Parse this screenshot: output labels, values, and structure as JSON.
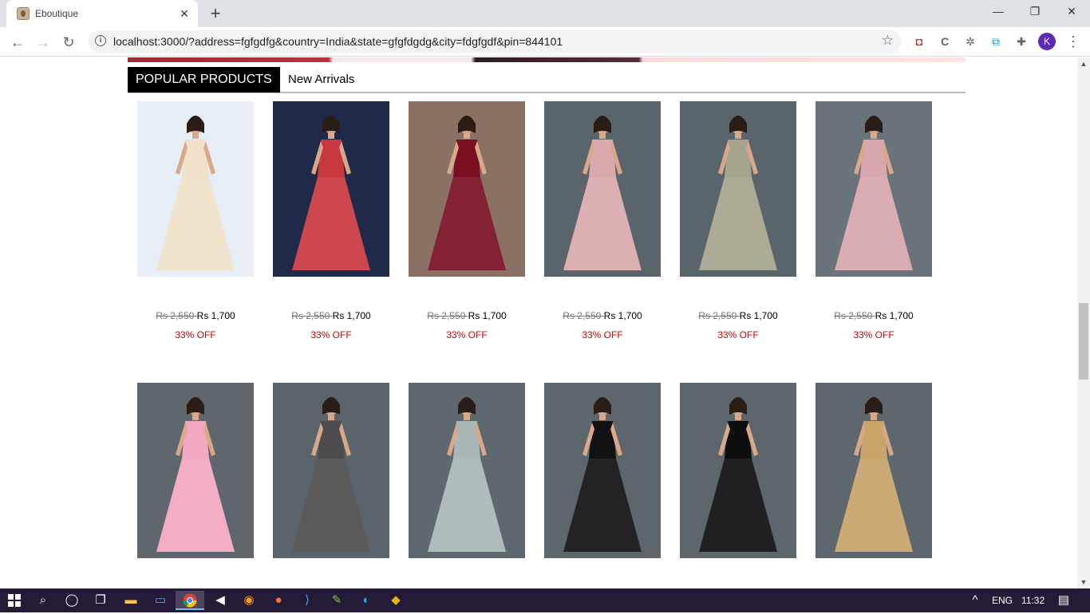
{
  "browser": {
    "tab_title": "Eboutique",
    "new_tab_symbol": "+",
    "url": "localhost:3000/?address=fgfgdfg&country=India&state=gfgfdgdg&city=fdgfgdf&pin=844101",
    "profile_initial": "K",
    "window_controls": {
      "minimize": "—",
      "restore": "❐",
      "close": "✕"
    }
  },
  "page": {
    "tabs": {
      "popular": "POPULAR PRODUCTS",
      "new_arrivals": "New Arrivals"
    },
    "products": [
      {
        "old_price": "Rs 2,550 ",
        "price": "Rs 1,700",
        "discount": "33% OFF",
        "dress_color": "#efe2c8",
        "background": "#e8eef5"
      },
      {
        "old_price": "Rs 2,550 ",
        "price": "Rs 1,700",
        "discount": "33% OFF",
        "dress_color": "#c8383f",
        "background": "#1e2a47"
      },
      {
        "old_price": "Rs 2,550 ",
        "price": "Rs 1,700",
        "discount": "33% OFF",
        "dress_color": "#7a0f22",
        "background": "#8b7064"
      },
      {
        "old_price": "Rs 2,550 ",
        "price": "Rs 1,700",
        "discount": "33% OFF",
        "dress_color": "#d9a9ad",
        "background": "#5a646b"
      },
      {
        "old_price": "Rs 2,550 ",
        "price": "Rs 1,700",
        "discount": "33% OFF",
        "dress_color": "#a7a48d",
        "background": "#5a646b"
      },
      {
        "old_price": "Rs 2,550 ",
        "price": "Rs 1,700",
        "discount": "33% OFF",
        "dress_color": "#d7a7ad",
        "background": "#6a7379"
      }
    ],
    "products_row2": [
      {
        "dress_color": "#f2a8c0",
        "background": "#5f676d"
      },
      {
        "dress_color": "#4e4c4e",
        "background": "#5b646a"
      },
      {
        "dress_color": "#a8b7b6",
        "background": "#5e686e"
      },
      {
        "dress_color": "#111114",
        "background": "#5c666b"
      },
      {
        "dress_color": "#0e0e10",
        "background": "#5c666b"
      },
      {
        "dress_color": "#c8a36a",
        "background": "#5e676d"
      }
    ]
  },
  "taskbar": {
    "language": "ENG",
    "time": "11:32"
  }
}
